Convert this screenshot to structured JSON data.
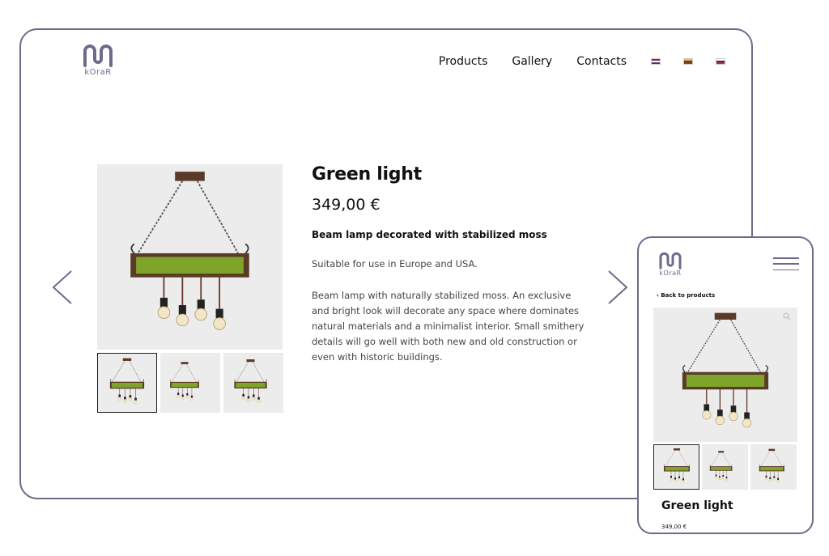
{
  "brand": {
    "name": "kOraR",
    "color": "#6f6a8c"
  },
  "nav": {
    "links": [
      "Products",
      "Gallery",
      "Contacts"
    ],
    "flags": [
      {
        "name": "netherlands-flag",
        "colors": [
          "#ae1c28",
          "#ffffff",
          "#21468b"
        ]
      },
      {
        "name": "lithuania-flag",
        "colors": [
          "#fdb913",
          "#006a44",
          "#c1272d"
        ]
      },
      {
        "name": "russia-flag",
        "colors": [
          "#ffffff",
          "#0039a6",
          "#d52b1e"
        ]
      }
    ]
  },
  "product": {
    "title": "Green light",
    "price": "349,00 €",
    "subtitle": "Beam lamp decorated with stabilized moss",
    "paragraphs": [
      "Suitable for use in Europe and USA.",
      "Beam lamp with naturally stabilized moss. An exclusive and bright look will decorate any space where dominates natural materials and a minimalist interior. Small smithery details will go well with both new and old construction or even with historic buildings."
    ]
  },
  "mobile": {
    "back_label": "‹ Back to products",
    "title": "Green light",
    "price": "349,00 €"
  },
  "icons": {
    "arrow_left": "chevron-left-icon",
    "arrow_right": "chevron-right-icon",
    "menu": "hamburger-menu-icon",
    "zoom": "zoom-icon"
  }
}
